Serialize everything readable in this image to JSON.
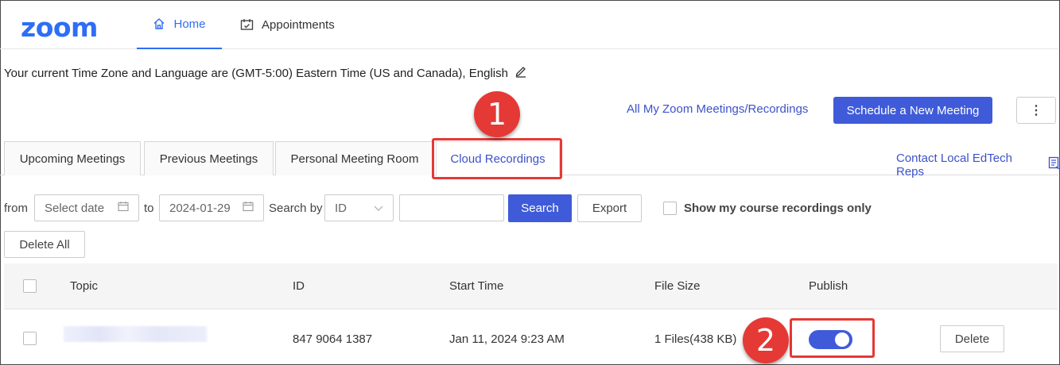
{
  "brand": {
    "logo_text": "zoom",
    "color": "#2d6ef6"
  },
  "nav": {
    "home_label": "Home",
    "home_icon": "home-icon",
    "appointments_label": "Appointments",
    "appointments_icon": "calendar-icon"
  },
  "timezone_text": "Your current Time Zone and Language are (GMT-5:00) Eastern Time (US and Canada), English",
  "actions": {
    "all_meetings_link": "All My Zoom Meetings/Recordings",
    "schedule_button": "Schedule a New Meeting",
    "more_button": "⋮"
  },
  "tabs": [
    {
      "label": "Upcoming Meetings",
      "active": false
    },
    {
      "label": "Previous Meetings",
      "active": false
    },
    {
      "label": "Personal Meeting Room",
      "active": false
    },
    {
      "label": "Cloud Recordings",
      "active": true
    }
  ],
  "contact_link": "Contact Local EdTech Reps",
  "filters": {
    "from_label": "from",
    "from_placeholder": "Select date",
    "to_label": "to",
    "to_value": "2024-01-29",
    "search_by_label": "Search by",
    "search_by_value": "ID",
    "search_input_value": "",
    "search_button": "Search",
    "export_button": "Export",
    "course_only_label": "Show my course recordings only",
    "delete_all_button": "Delete All"
  },
  "table": {
    "headers": {
      "topic": "Topic",
      "id": "ID",
      "start_time": "Start Time",
      "file_size": "File Size",
      "publish": "Publish"
    },
    "rows": [
      {
        "topic": "",
        "id": "847 9064 1387",
        "start_time": "Jan 11, 2024 9:23 AM",
        "file_size": "1 Files(438 KB)",
        "published": true,
        "delete_label": "Delete"
      }
    ]
  },
  "annotations": {
    "marker_1": "1",
    "marker_2": "2",
    "color": "#e53935"
  },
  "accent_color": "#3f5bd9"
}
